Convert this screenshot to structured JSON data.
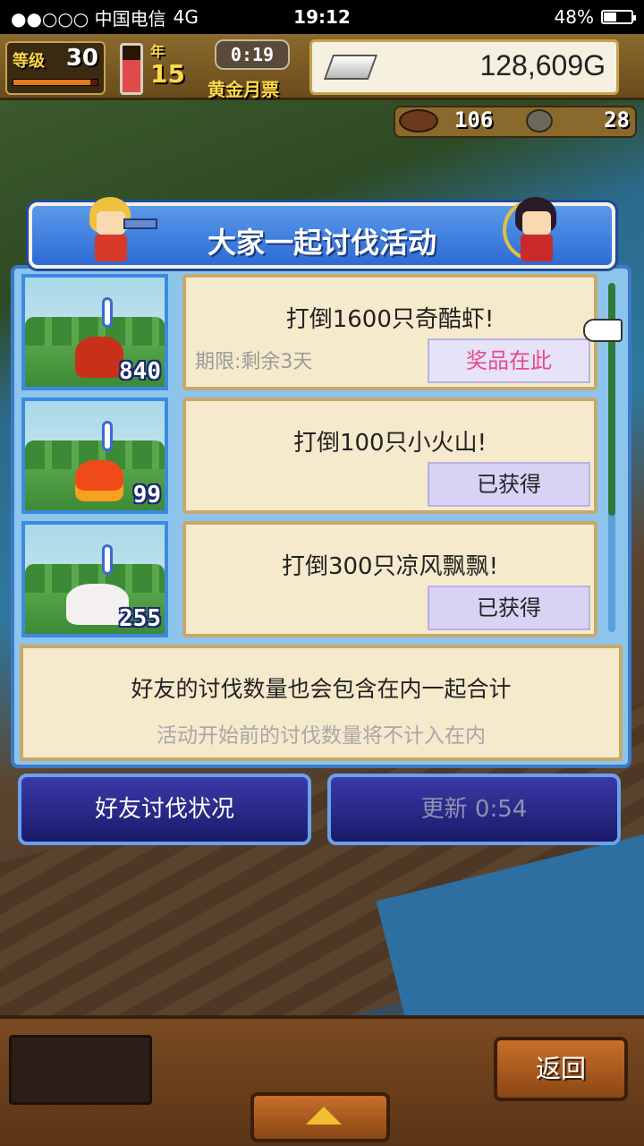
{
  "status_bar": {
    "carrier": "●●○○○ 中国电信",
    "network": "4G",
    "time": "19:12",
    "battery_text": "48%",
    "battery_level": 0.48
  },
  "hud": {
    "level_label": "等级",
    "level_value": "30",
    "level_progress": 0.92,
    "gauge_level": 0.7,
    "year_label": "年",
    "year_value": "15",
    "timer": "0:19",
    "month_label": "黄金月票",
    "gold": "128,609G",
    "resource1": "106",
    "resource2": "28"
  },
  "panel": {
    "title": "大家一起讨伐活动",
    "missions": [
      {
        "count": "840",
        "title": "打倒1600只奇酷虾!",
        "deadline": "期限:剩余3天",
        "button": "奖品在此",
        "monster_icon": "red-shrimp-monster"
      },
      {
        "count": "99",
        "title": "打倒100只小火山!",
        "deadline": "",
        "button": "已获得",
        "monster_icon": "fire-volcano-monster"
      },
      {
        "count": "255",
        "title": "打倒300只凉风飘飘!",
        "deadline": "",
        "button": "已获得",
        "monster_icon": "white-ghost-monster"
      }
    ],
    "info_main": "好友的讨伐数量也会包含在内一起合计",
    "info_sub": "活动开始前的讨伐数量将不计入在内"
  },
  "buttons": {
    "friends": "好友讨伐状况",
    "refresh": "更新 0:54",
    "back": "返回"
  },
  "colors": {
    "panel_blue": "#3a7ac8",
    "card_bg": "#f6eacc",
    "prize_pink": "#e84a8a",
    "button_navy": "#1a1a6a",
    "wood": "#7a4a22"
  }
}
